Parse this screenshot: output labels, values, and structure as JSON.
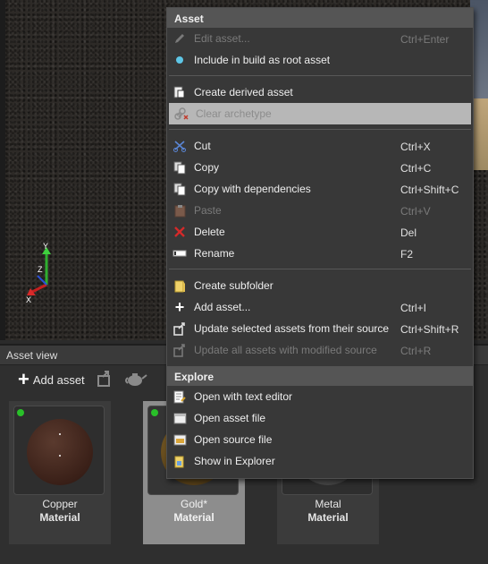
{
  "menu": {
    "asset_header": "Asset",
    "explore_header": "Explore",
    "items": {
      "edit_asset": {
        "label": "Edit asset...",
        "shortcut": "Ctrl+Enter"
      },
      "include_root": {
        "label": "Include in build as root asset"
      },
      "create_derived": {
        "label": "Create derived asset"
      },
      "clear_archetype": {
        "label": "Clear archetype"
      },
      "cut": {
        "label": "Cut",
        "shortcut": "Ctrl+X"
      },
      "copy": {
        "label": "Copy",
        "shortcut": "Ctrl+C"
      },
      "copy_deps": {
        "label": "Copy with dependencies",
        "shortcut": "Ctrl+Shift+C"
      },
      "paste": {
        "label": "Paste",
        "shortcut": "Ctrl+V"
      },
      "delete": {
        "label": "Delete",
        "shortcut": "Del"
      },
      "rename": {
        "label": "Rename",
        "shortcut": "F2"
      },
      "create_subfolder": {
        "label": "Create subfolder"
      },
      "add_asset": {
        "label": "Add asset...",
        "shortcut": "Ctrl+I"
      },
      "update_selected": {
        "label": "Update selected assets from their source",
        "shortcut": "Ctrl+Shift+R"
      },
      "update_all": {
        "label": "Update all assets with modified source",
        "shortcut": "Ctrl+R"
      },
      "open_text_editor": {
        "label": "Open with text editor"
      },
      "open_asset_file": {
        "label": "Open asset file"
      },
      "open_source_file": {
        "label": "Open source file"
      },
      "show_in_explorer": {
        "label": "Show in Explorer"
      }
    }
  },
  "asset_view": {
    "title": "Asset view",
    "add_asset_label": "Add asset",
    "tiles": [
      {
        "name": "Copper",
        "type": "Material"
      },
      {
        "name": "Gold*",
        "type": "Material"
      },
      {
        "name": "Metal",
        "type": "Material"
      }
    ]
  },
  "gizmo": {
    "x": "X",
    "y": "Y",
    "z": "Z"
  },
  "colors": {
    "status_green": "#29c029",
    "highlight": "#b7b7b7",
    "menu_bg": "#383838"
  }
}
